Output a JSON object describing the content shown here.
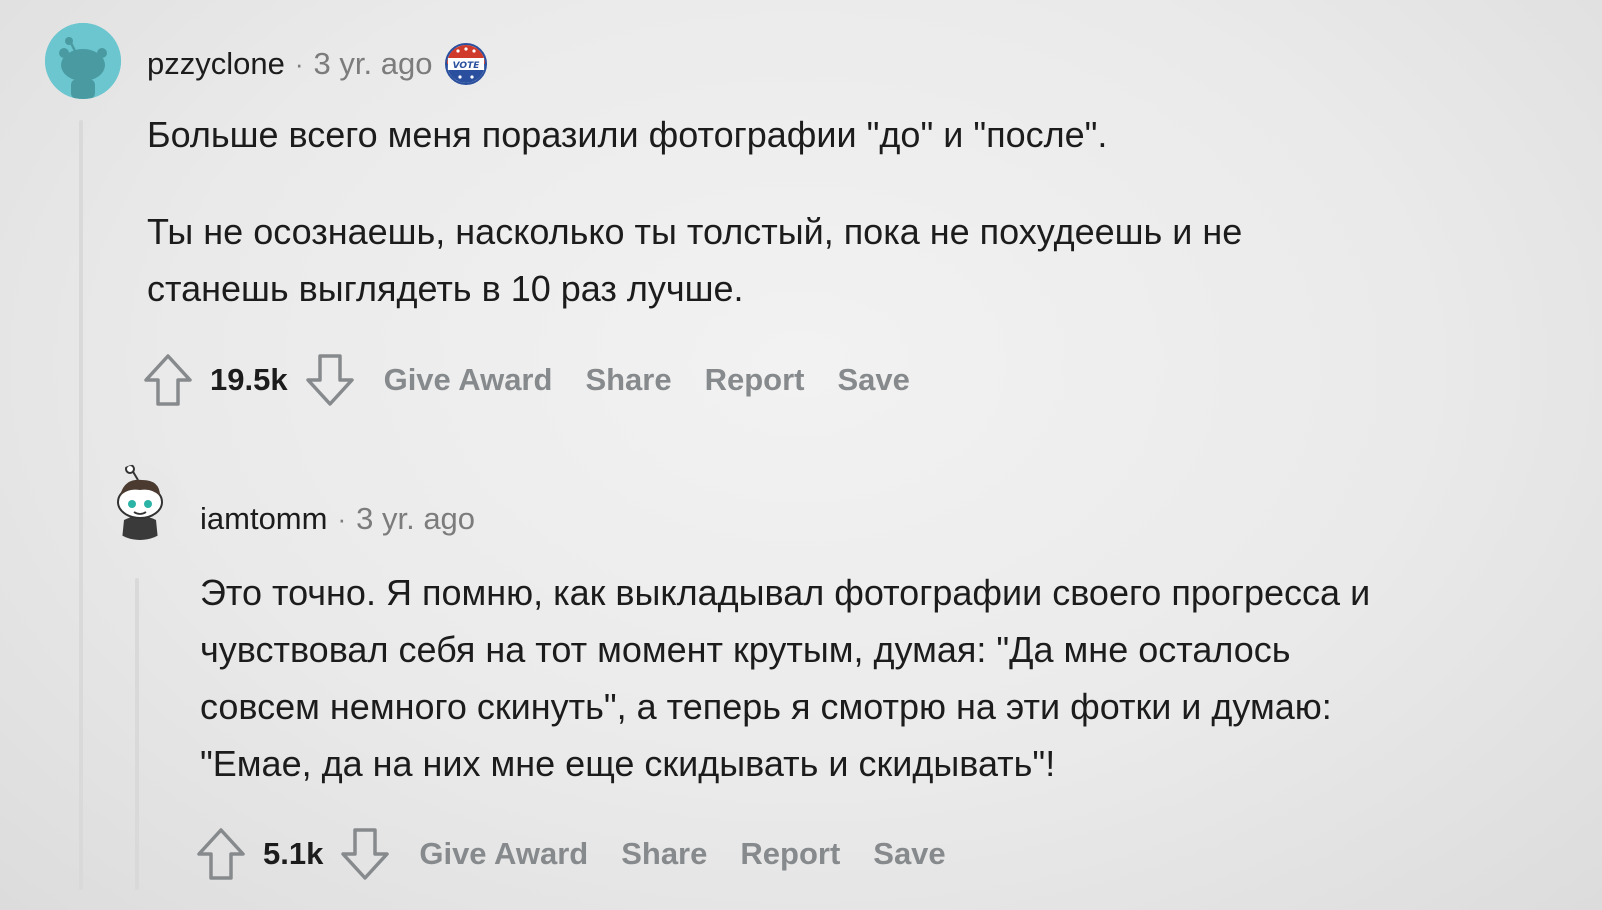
{
  "comments": [
    {
      "username": "pzzyclone",
      "separator": "·",
      "time": "3 yr. ago",
      "award_icon": "vote-badge-icon",
      "paragraphs": [
        "Больше всего меня поразили фотографии \"до\" и \"после\".",
        "Ты не осознаешь, насколько ты толстый, пока не похудеешь и не",
        "станешь выглядеть в 10 раз лучше."
      ],
      "score": "19.5k",
      "actions": {
        "give_award": "Give Award",
        "share": "Share",
        "report": "Report",
        "save": "Save"
      }
    },
    {
      "username": "iamtomm",
      "separator": "·",
      "time": "3 yr. ago",
      "lines": [
        "Это точно. Я помню, как выкладывал фотографии своего прогресса и",
        "чувствовал себя на тот момент крутым, думая: \"Да мне осталось",
        "совсем немного скинуть\", а теперь я смотрю на эти фотки и думаю:",
        "\"Емае, да на них мне еще скидывать и скидывать\"!"
      ],
      "score": "5.1k",
      "actions": {
        "give_award": "Give Award",
        "share": "Share",
        "report": "Report",
        "save": "Save"
      }
    }
  ],
  "colors": {
    "text": "#1c1c1c",
    "meta": "#7c7c7c",
    "action": "#878a8c",
    "thread_line": "#d9d9d9",
    "avatar_1_bg": "#6cc6cf"
  }
}
